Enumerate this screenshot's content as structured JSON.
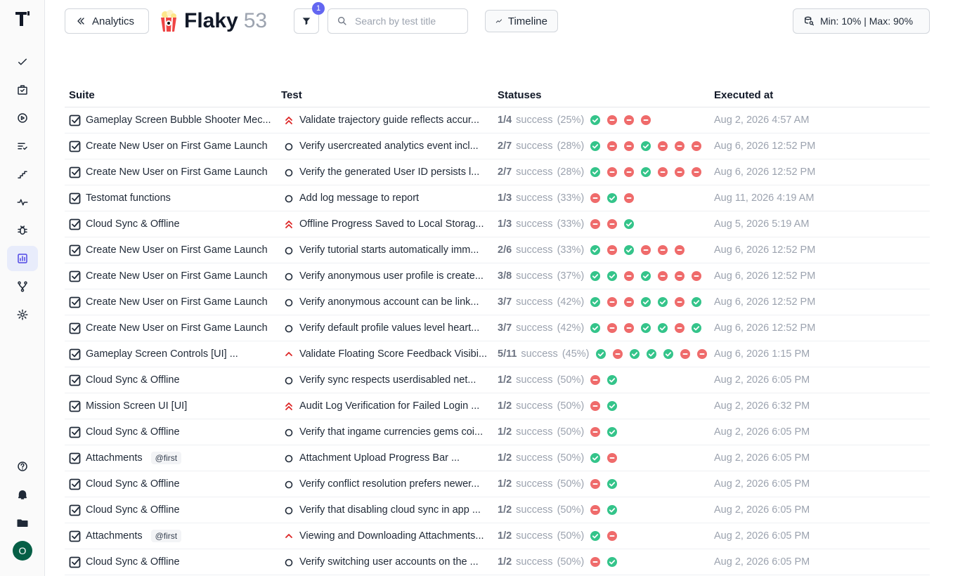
{
  "header": {
    "back_label": "Analytics",
    "title": "Flaky",
    "count": "53",
    "filter_badge": "1",
    "search_placeholder": "Search by test title",
    "timeline_label": "Timeline",
    "minmax_label": "Min: 10% | Max: 90%"
  },
  "sidebar": {
    "items": [
      "checkmark-icon",
      "briefcase-icon",
      "play-icon",
      "checklist-icon",
      "steps-icon",
      "pulse-icon",
      "bug-icon",
      "analytics-icon",
      "branch-icon",
      "gear-icon"
    ],
    "bottom": [
      "help-icon",
      "bell-icon",
      "folder-icon"
    ],
    "avatar": "O",
    "active": "analytics-icon"
  },
  "colors": {
    "accent": "#6366f1",
    "success": "#34c48a",
    "fail": "#ef6b6b",
    "critical": "#dc2626"
  },
  "table": {
    "columns": [
      "Suite",
      "Test",
      "Statuses",
      "Executed at"
    ],
    "rows": [
      {
        "suite": "Gameplay Screen Bubble Shooter Mec...",
        "tag": "",
        "prio": "high",
        "test": "Validate trajectory guide reflects accur...",
        "ratio": "1/4",
        "pct": "(25%)",
        "statuses": [
          "s",
          "f",
          "f",
          "f"
        ],
        "executed": "Aug 2, 2026 4:57 AM"
      },
      {
        "suite": "Create New User on First Game Launch",
        "tag": "",
        "prio": "normal",
        "test": "Verify usercreated analytics event incl...",
        "ratio": "2/7",
        "pct": "(28%)",
        "statuses": [
          "s",
          "f",
          "f",
          "s",
          "f",
          "f",
          "f"
        ],
        "executed": "Aug 6, 2026 12:52 PM"
      },
      {
        "suite": "Create New User on First Game Launch",
        "tag": "",
        "prio": "normal",
        "test": "Verify the generated User ID persists l...",
        "ratio": "2/7",
        "pct": "(28%)",
        "statuses": [
          "s",
          "f",
          "f",
          "s",
          "f",
          "f",
          "f"
        ],
        "executed": "Aug 6, 2026 12:52 PM"
      },
      {
        "suite": "Testomat functions",
        "tag": "",
        "prio": "normal",
        "test": "Add log message to report",
        "ratio": "1/3",
        "pct": "(33%)",
        "statuses": [
          "f",
          "s",
          "f"
        ],
        "executed": "Aug 11, 2026 4:19 AM"
      },
      {
        "suite": "Cloud Sync & Offline",
        "tag": "",
        "prio": "high",
        "test": "Offline Progress Saved to Local Storag...",
        "ratio": "1/3",
        "pct": "(33%)",
        "statuses": [
          "f",
          "f",
          "s"
        ],
        "executed": "Aug 5, 2026 5:19 AM"
      },
      {
        "suite": "Create New User on First Game Launch",
        "tag": "",
        "prio": "normal",
        "test": "Verify tutorial starts automatically imm...",
        "ratio": "2/6",
        "pct": "(33%)",
        "statuses": [
          "s",
          "f",
          "s",
          "f",
          "f",
          "f"
        ],
        "executed": "Aug 6, 2026 12:52 PM"
      },
      {
        "suite": "Create New User on First Game Launch",
        "tag": "",
        "prio": "normal",
        "test": "Verify anonymous user profile is create...",
        "ratio": "3/8",
        "pct": "(37%)",
        "statuses": [
          "s",
          "s",
          "f",
          "s",
          "f",
          "f",
          "f"
        ],
        "executed": "Aug 6, 2026 12:52 PM"
      },
      {
        "suite": "Create New User on First Game Launch",
        "tag": "",
        "prio": "normal",
        "test": "Verify anonymous account can be link...",
        "ratio": "3/7",
        "pct": "(42%)",
        "statuses": [
          "s",
          "f",
          "f",
          "s",
          "s",
          "f",
          "s"
        ],
        "executed": "Aug 6, 2026 12:52 PM"
      },
      {
        "suite": "Create New User on First Game Launch",
        "tag": "",
        "prio": "normal",
        "test": "Verify default profile values level heart...",
        "ratio": "3/7",
        "pct": "(42%)",
        "statuses": [
          "s",
          "f",
          "f",
          "s",
          "s",
          "f",
          "s"
        ],
        "executed": "Aug 6, 2026 12:52 PM"
      },
      {
        "suite": "Gameplay Screen Controls [UI] ...",
        "tag": "",
        "prio": "low",
        "test": "Validate Floating Score Feedback Visibi...",
        "ratio": "5/11",
        "pct": "(45%)",
        "statuses": [
          "s",
          "f",
          "s",
          "s",
          "s",
          "f",
          "f"
        ],
        "executed": "Aug 6, 2026 1:15 PM"
      },
      {
        "suite": "Cloud Sync & Offline",
        "tag": "",
        "prio": "normal",
        "test": "Verify sync respects userdisabled net...",
        "ratio": "1/2",
        "pct": "(50%)",
        "statuses": [
          "f",
          "s"
        ],
        "executed": "Aug 2, 2026 6:05 PM"
      },
      {
        "suite": "Mission Screen UI [UI]",
        "tag": "",
        "prio": "high",
        "test": "Audit Log Verification for Failed Login ...",
        "ratio": "1/2",
        "pct": "(50%)",
        "statuses": [
          "f",
          "s"
        ],
        "executed": "Aug 2, 2026 6:32 PM"
      },
      {
        "suite": "Cloud Sync & Offline",
        "tag": "",
        "prio": "normal",
        "test": "Verify that ingame currencies gems coi...",
        "ratio": "1/2",
        "pct": "(50%)",
        "statuses": [
          "f",
          "s"
        ],
        "executed": "Aug 2, 2026 6:05 PM"
      },
      {
        "suite": "Attachments",
        "tag": "@first",
        "prio": "normal",
        "test": "Attachment Upload Progress Bar ...",
        "ratio": "1/2",
        "pct": "(50%)",
        "statuses": [
          "s",
          "f"
        ],
        "executed": "Aug 2, 2026 6:05 PM"
      },
      {
        "suite": "Cloud Sync & Offline",
        "tag": "",
        "prio": "normal",
        "test": "Verify conflict resolution prefers newer...",
        "ratio": "1/2",
        "pct": "(50%)",
        "statuses": [
          "f",
          "s"
        ],
        "executed": "Aug 2, 2026 6:05 PM"
      },
      {
        "suite": "Cloud Sync & Offline",
        "tag": "",
        "prio": "normal",
        "test": "Verify that disabling cloud sync in app ...",
        "ratio": "1/2",
        "pct": "(50%)",
        "statuses": [
          "f",
          "s"
        ],
        "executed": "Aug 2, 2026 6:05 PM"
      },
      {
        "suite": "Attachments",
        "tag": "@first",
        "prio": "low",
        "test": "Viewing and Downloading Attachments...",
        "ratio": "1/2",
        "pct": "(50%)",
        "statuses": [
          "s",
          "f"
        ],
        "executed": "Aug 2, 2026 6:05 PM"
      },
      {
        "suite": "Cloud Sync & Offline",
        "tag": "",
        "prio": "normal",
        "test": "Verify switching user accounts on the ...",
        "ratio": "1/2",
        "pct": "(50%)",
        "statuses": [
          "f",
          "s"
        ],
        "executed": "Aug 2, 2026 6:05 PM"
      }
    ],
    "success_word": "success"
  }
}
